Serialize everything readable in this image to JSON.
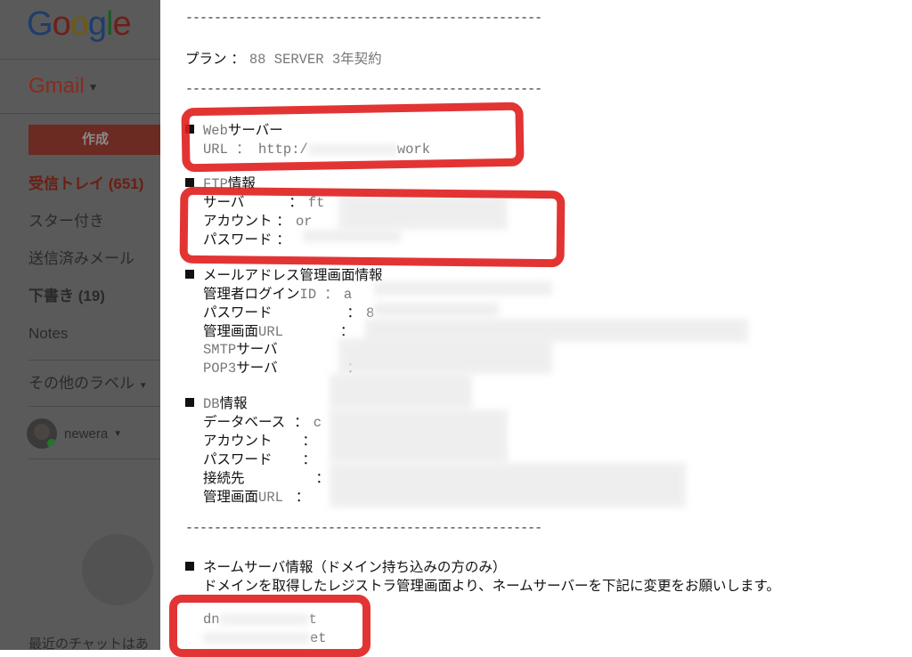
{
  "gmail": {
    "logo": "Google",
    "app_name": "Gmail",
    "compose_label": "作成",
    "nav": [
      {
        "label": "受信トレイ (651)"
      },
      {
        "label": "スター付き"
      },
      {
        "label": "送信済みメール"
      },
      {
        "label": "下書き (19)"
      },
      {
        "label": "Notes"
      }
    ],
    "more_labels": "その他のラベル",
    "user_name": "newera",
    "chat_note": "最近のチャットはあ"
  },
  "email": {
    "separator": "--------------------------------------------------",
    "plan_label": "プラン ： ",
    "plan_value": "88 SERVER 3年契約",
    "web": {
      "heading_prefix": "Web",
      "heading_jp": "サーバー",
      "url_label": "URL ： http:/",
      "url_tail": "work"
    },
    "ftp": {
      "heading_prefix": "FTP",
      "heading_jp": "情報",
      "server": "サーバ",
      "server_sep": "：",
      "server_value": "ft",
      "account": "アカウント ：",
      "account_value": "or",
      "password": "パスワード ："
    },
    "mail": {
      "heading": "メールアドレス管理画面情報",
      "admin_login": "管理者ログイン",
      "admin_login_suffix": "ID ：",
      "admin_login_value": "a",
      "password": "パスワード",
      "password_sep": "：",
      "password_value": "8",
      "admin_url": "管理画面",
      "admin_url_suffix": "URL",
      "admin_url_sep": "：",
      "smtp_prefix": "SMTP",
      "smtp_jp": "サーバ",
      "pop3_prefix": "POP3",
      "pop3_jp": "サーバ",
      "pop3_sep": "："
    },
    "db": {
      "heading_prefix": "DB",
      "heading_jp": "情報",
      "database": "データベース",
      "database_sep": "：",
      "database_value": "c",
      "account": "アカウント",
      "account_sep": "：",
      "password": "パスワード",
      "password_sep": "：",
      "host": "接続先",
      "host_sep": "：",
      "admin_url": "管理画面",
      "admin_url_suffix": "URL",
      "admin_url_sep": "："
    },
    "nameserver": {
      "heading": "ネームサーバ情報（ドメイン持ち込みの方のみ）",
      "instruction": "ドメインを取得したレジストラ管理画面より、ネームサーバーを下記に変更をお願いします。",
      "ns1_prefix": "dn",
      "ns1_tail": "t",
      "ns2_tail": "et"
    }
  },
  "colors": {
    "redaction": "#e01e1e",
    "sidebar_overlay": "#5a5a5a"
  }
}
